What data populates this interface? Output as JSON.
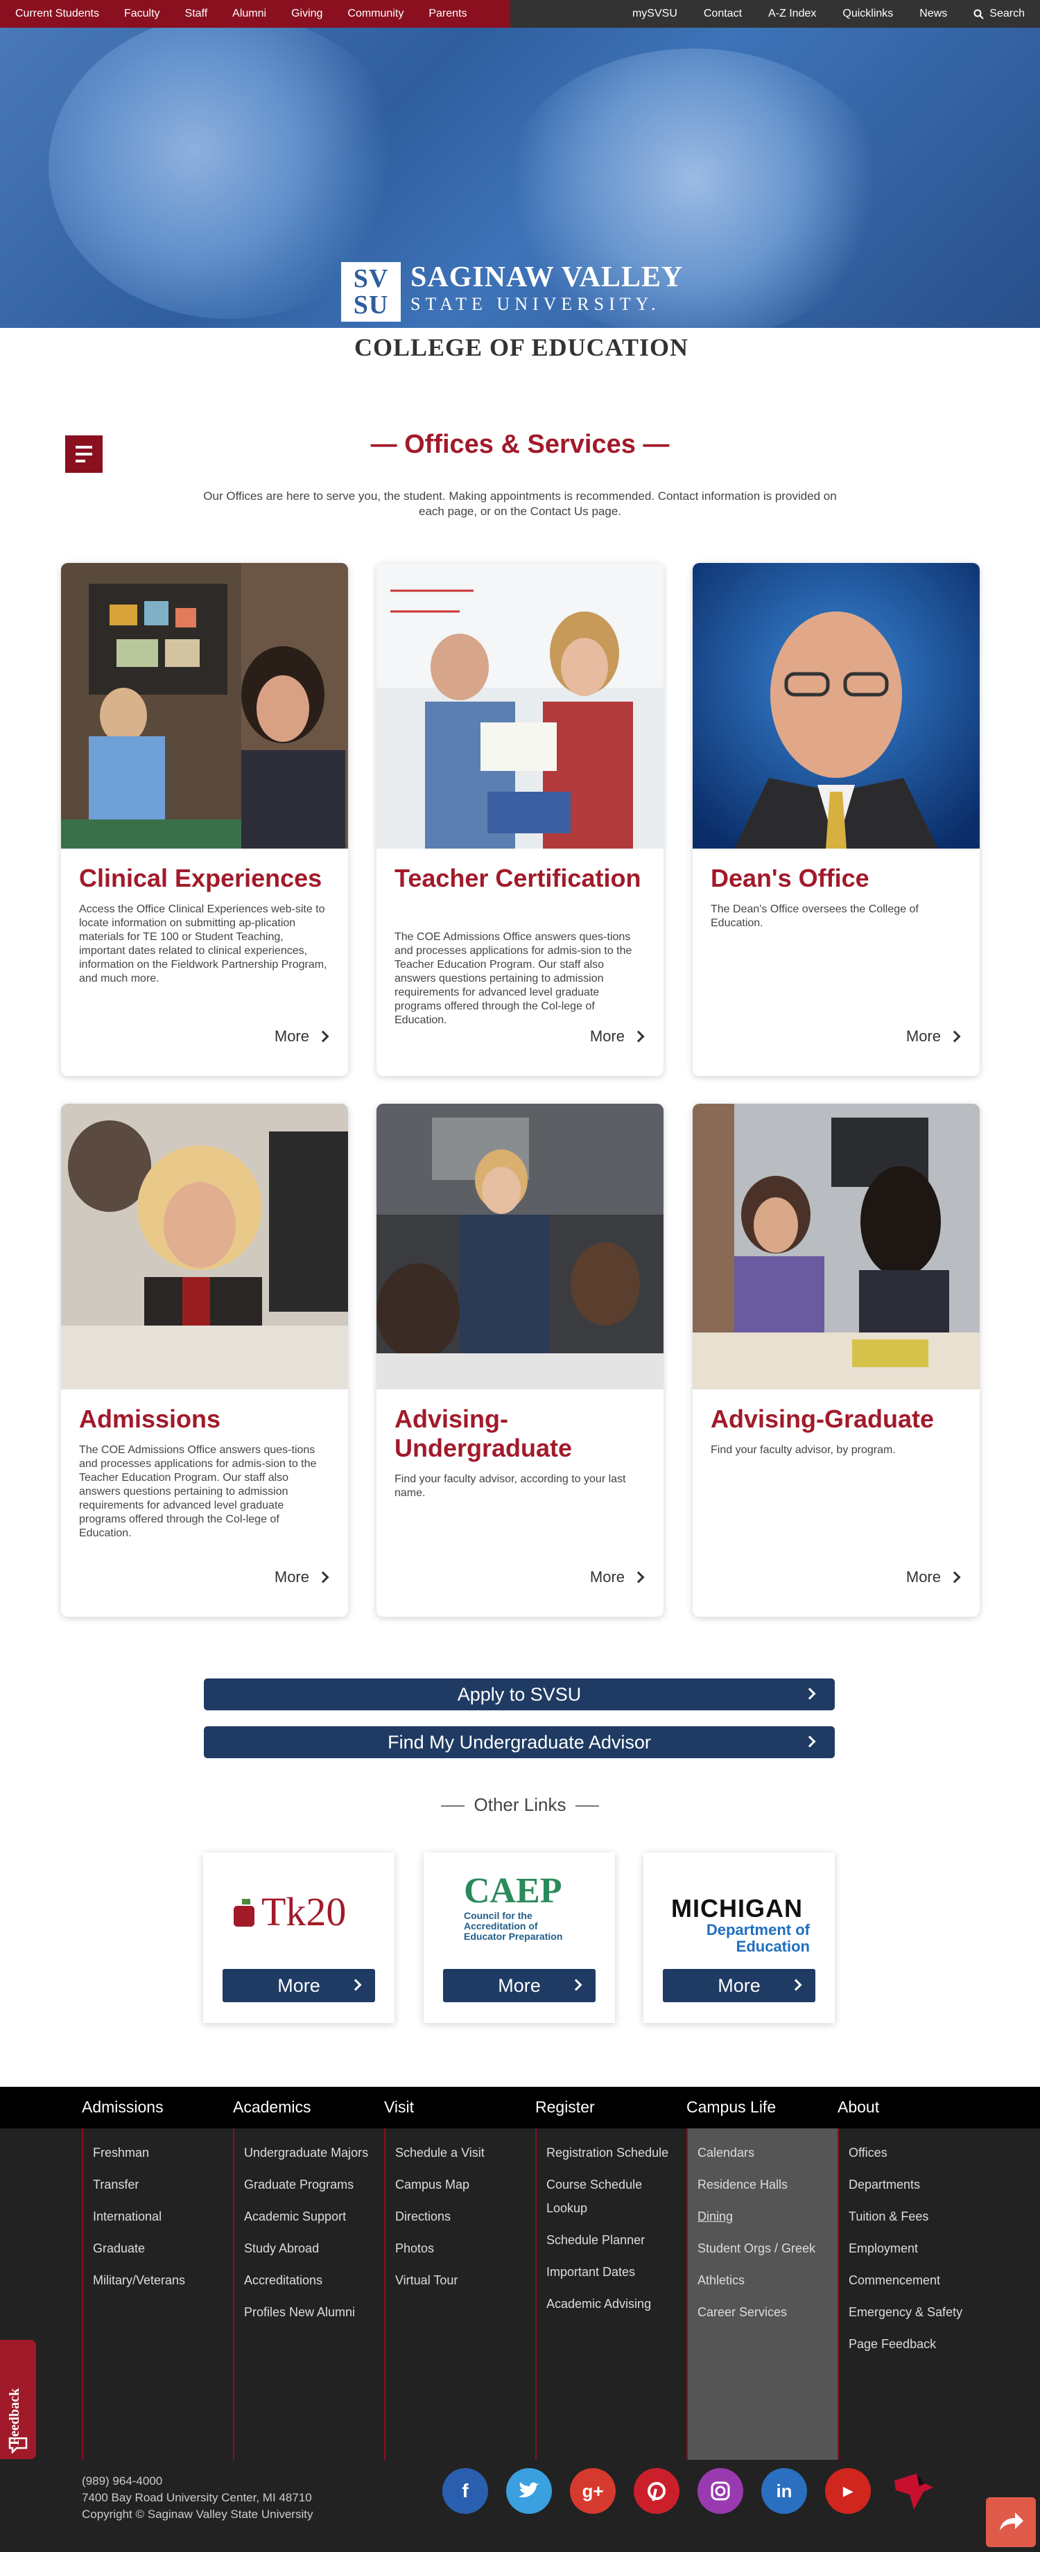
{
  "topnav": {
    "left": [
      "Current Students",
      "Faculty",
      "Staff",
      "Alumni",
      "Giving",
      "Community",
      "Parents"
    ],
    "right": [
      "mySVSU",
      "Contact",
      "A-Z Index",
      "Quicklinks",
      "News"
    ],
    "search": "Search"
  },
  "logo": {
    "mark_top": "SV",
    "mark_bottom": "SU",
    "line1": "SAGINAW VALLEY",
    "line2": "STATE UNIVERSITY.",
    "college": "COLLEGE OF EDUCATION"
  },
  "section": {
    "title": "— Offices & Services —",
    "intro": "Our Offices are here to serve you, the student. Making appointments is recommended. Contact information is provided on each page, or on the Contact Us page."
  },
  "cards": [
    {
      "title": "Clinical Experiences",
      "text": "Access the Office Clinical Experiences web-site to locate information on submitting ap-plication materials for TE 100 or Student Teaching, important dates related to clinical experiences, information on the Fieldwork Partnership Program, and much more.",
      "more": "More"
    },
    {
      "title": "Teacher Certification",
      "text": "The COE Admissions Office answers ques-tions and processes applications for admis-sion to the Teacher Education Program.  Our staff also answers questions pertaining to admission requirements for advanced level graduate programs offered through the Col-lege of Education.",
      "more": "More"
    },
    {
      "title": "Dean's Office",
      "text": "The Dean's Office oversees the College of Education.",
      "more": "More"
    },
    {
      "title": "Admissions",
      "text": "The COE Admissions Office answers ques-tions and processes applications for admis-sion to the Teacher Education Program.  Our staff also answers questions pertaining to admission requirements for advanced level graduate programs offered through the Col-lege of Education.",
      "more": "More"
    },
    {
      "title": "Advising-Undergraduate",
      "text": "Find your faculty advisor, according to your last name.",
      "more": "More"
    },
    {
      "title": "Advising-Graduate",
      "text": "Find your faculty advisor, by program.",
      "more": "More"
    }
  ],
  "buttons": {
    "apply": "Apply to SVSU",
    "advisor": "Find My Undergraduate Advisor"
  },
  "other_links": {
    "title": "Other Links",
    "items": [
      {
        "logo": "Tk20",
        "more": "More"
      },
      {
        "logo": "CAEP",
        "sub": "Council for the Accreditation of Educator Preparation",
        "more": "More"
      },
      {
        "logo": "MICHIGAN",
        "sub": "Department of Education",
        "more": "More"
      }
    ]
  },
  "footer": {
    "columns": [
      {
        "head": "Admissions",
        "items": [
          "Freshman",
          "Transfer",
          "International",
          "Graduate",
          "Military/Veterans"
        ]
      },
      {
        "head": "Academics",
        "items": [
          "Undergraduate Majors",
          "Graduate Programs",
          "Academic Support",
          "Study Abroad",
          "Accreditations",
          "Profiles New Alumni"
        ]
      },
      {
        "head": "Visit",
        "items": [
          "Schedule a Visit",
          "Campus Map",
          "Directions",
          "Photos",
          "Virtual Tour"
        ]
      },
      {
        "head": "Register",
        "items": [
          "Registration Schedule",
          "Course Schedule Lookup",
          "Schedule Planner",
          "Important Dates",
          "Academic Advising"
        ]
      },
      {
        "head": "Campus Life",
        "items": [
          "Calendars",
          "Residence Halls",
          "Dining",
          "Student Orgs / Greek",
          "Athletics",
          "Career Services"
        ]
      },
      {
        "head": "About",
        "items": [
          "Offices",
          "Departments",
          "Tuition & Fees",
          "Employment",
          "Commencement",
          "Emergency & Safety",
          "Page Feedback"
        ]
      }
    ],
    "phone": "(989) 964-4000",
    "address": "7400 Bay Road University Center, MI 48710",
    "copyright": "Copyright © Saginaw Valley State University",
    "feedback": "Feedback",
    "social": [
      "facebook-icon",
      "twitter-icon",
      "google-plus-icon",
      "pinterest-icon",
      "instagram-icon",
      "linkedin-icon",
      "youtube-icon"
    ]
  }
}
